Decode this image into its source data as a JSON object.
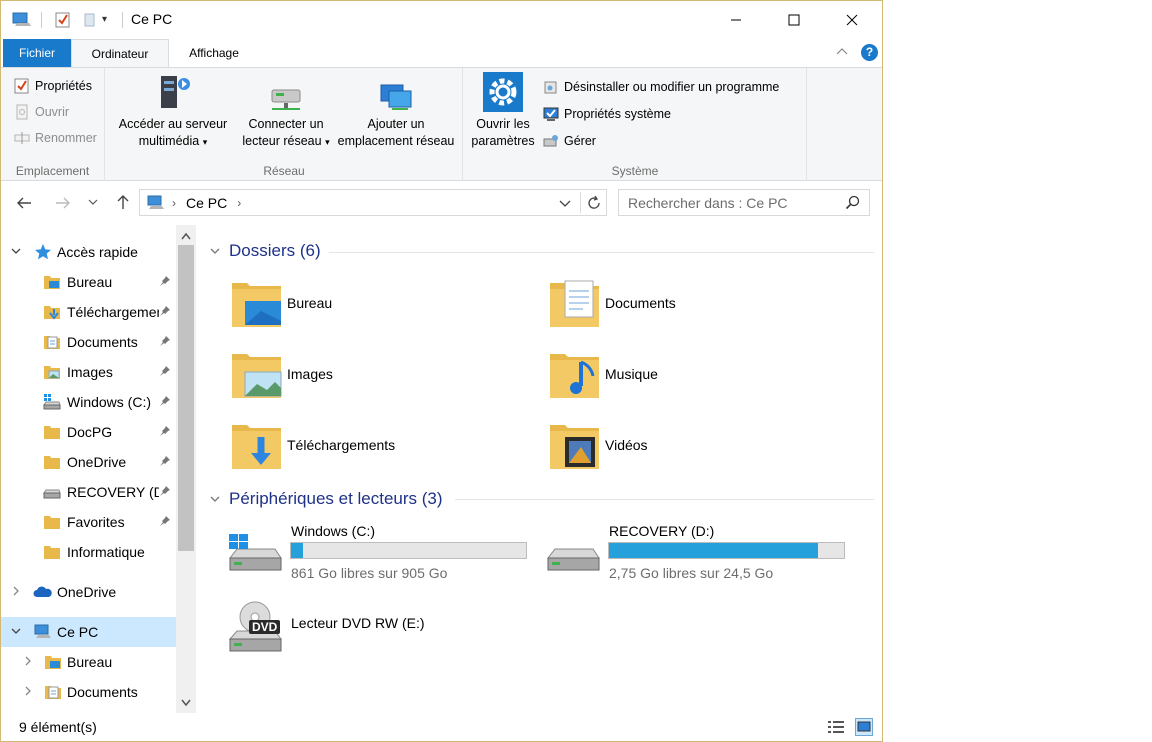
{
  "window": {
    "title": "Ce PC",
    "accent": "#1979ca"
  },
  "tabs": {
    "file": "Fichier",
    "computer": "Ordinateur",
    "view": "Affichage"
  },
  "ribbon": {
    "location": {
      "label": "Emplacement",
      "properties": "Propriétés",
      "open": "Ouvrir",
      "rename": "Renommer"
    },
    "network": {
      "label": "Réseau",
      "media_line1": "Accéder au serveur",
      "media_line2": "multimédia",
      "map_line1": "Connecter un",
      "map_line2": "lecteur réseau",
      "add_line1": "Ajouter un",
      "add_line2": "emplacement réseau"
    },
    "system": {
      "label": "Système",
      "settings_line1": "Ouvrir les",
      "settings_line2": "paramètres",
      "uninstall": "Désinstaller ou modifier un programme",
      "sysprops": "Propriétés système",
      "manage": "Gérer"
    }
  },
  "address": {
    "location": "Ce PC",
    "search_placeholder": "Rechercher dans : Ce PC"
  },
  "nav": {
    "quick_access": "Accès rapide",
    "items": [
      {
        "label": "Bureau",
        "icon": "desktop-folder-icon",
        "pinned": true
      },
      {
        "label": "Téléchargements",
        "icon": "downloads-folder-icon",
        "pinned": true
      },
      {
        "label": "Documents",
        "icon": "documents-folder-icon",
        "pinned": true
      },
      {
        "label": "Images",
        "icon": "pictures-folder-icon",
        "pinned": true
      },
      {
        "label": "Windows (C:)",
        "icon": "windows-drive-icon",
        "pinned": true
      },
      {
        "label": "DocPG",
        "icon": "folder-icon",
        "pinned": true
      },
      {
        "label": "OneDrive",
        "icon": "folder-icon",
        "pinned": true
      },
      {
        "label": "RECOVERY (D:)",
        "icon": "drive-icon",
        "pinned": true
      },
      {
        "label": "Favorites",
        "icon": "folder-icon",
        "pinned": true
      },
      {
        "label": "Informatique",
        "icon": "folder-icon",
        "pinned": false
      }
    ],
    "onedrive": "OneDrive",
    "this_pc": "Ce PC",
    "this_pc_children": [
      "Bureau",
      "Documents"
    ]
  },
  "content": {
    "folders_header": "Dossiers (6)",
    "folders": [
      {
        "label": "Bureau",
        "icon": "desktop-folder-icon"
      },
      {
        "label": "Documents",
        "icon": "documents-folder-icon"
      },
      {
        "label": "Images",
        "icon": "pictures-folder-icon"
      },
      {
        "label": "Musique",
        "icon": "music-folder-icon"
      },
      {
        "label": "Téléchargements",
        "icon": "downloads-folder-icon"
      },
      {
        "label": "Vidéos",
        "icon": "videos-folder-icon"
      }
    ],
    "drives_header": "Périphériques et lecteurs (3)",
    "drives": [
      {
        "label": "Windows (C:)",
        "free": "861 Go libres sur 905 Go",
        "used_fraction": 0.049
      },
      {
        "label": "RECOVERY (D:)",
        "free": "2,75 Go libres sur 24,5 Go",
        "used_fraction": 0.888
      },
      {
        "label": "Lecteur DVD RW (E:)",
        "dvd_badge": "DVD"
      }
    ]
  },
  "status": {
    "count": "9 élément(s)"
  }
}
